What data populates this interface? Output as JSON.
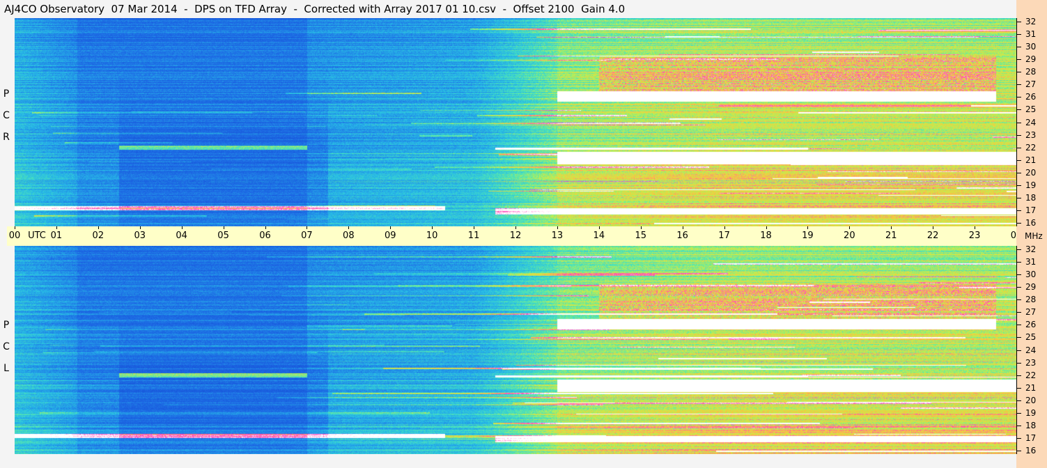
{
  "title": "AJ4CO Observatory  07 Mar 2014  -  DPS on TFD Array  -  Corrected with Array 2017 01 10.csv  -  Offset 2100  Gain 4.0",
  "panels": [
    {
      "id": "top",
      "polarization_letters": [
        "P",
        "C",
        "R"
      ]
    },
    {
      "id": "bottom",
      "polarization_letters": [
        "P",
        "C",
        "L"
      ]
    }
  ],
  "time_axis": {
    "labels": [
      "00",
      "01",
      "02",
      "03",
      "04",
      "05",
      "06",
      "07",
      "08",
      "09",
      "10",
      "11",
      "12",
      "13",
      "14",
      "15",
      "16",
      "17",
      "18",
      "19",
      "20",
      "21",
      "22",
      "23",
      "00"
    ],
    "utc_label": "UTC",
    "unit_label": "MHz"
  },
  "freq_axis": {
    "labels": [
      "32",
      "31",
      "30",
      "29",
      "28",
      "27",
      "26",
      "25",
      "24",
      "23",
      "22",
      "21",
      "20",
      "19",
      "18",
      "17",
      "16"
    ]
  },
  "colors": {
    "background": "#f4f4f4",
    "time_band": "#ffffc8",
    "freq_strip": "#fcd9b8",
    "low_intensity": "#1a5fd6",
    "mid_intensity": "#33c8e0",
    "high_intensity": "#ff40c0",
    "saturated": "#ffffff"
  },
  "chart_data": {
    "type": "heatmap",
    "title": "AJ4CO Observatory  07 Mar 2014  -  DPS on TFD Array  -  Corrected with Array 2017 01 10.csv  -  Offset 2100  Gain 4.0",
    "xlabel": "UTC",
    "ylabel": "MHz",
    "xlim": [
      0,
      24
    ],
    "ylim": [
      16,
      32
    ],
    "panels": [
      "RCP",
      "LCP"
    ],
    "description_points": [
      {
        "utc": 2,
        "activity": "low",
        "bright_bands_mhz": [
          17.7,
          19.5,
          21.7
        ]
      },
      {
        "utc": 5,
        "activity": "lowest",
        "bright_bands_mhz": [
          17.7,
          21.7
        ]
      },
      {
        "utc": 10,
        "activity": "low",
        "bright_bands_mhz": [
          17.6
        ]
      },
      {
        "utc": 11,
        "activity": "low",
        "bright_bands_mhz": []
      },
      {
        "utc": 13,
        "activity": "rising",
        "bright_bands_mhz": [
          17.5,
          21.9,
          27
        ]
      },
      {
        "utc": 18,
        "activity": "high",
        "bright_bands_mhz": [
          17.5,
          20.5,
          22,
          26.8,
          27.5
        ]
      },
      {
        "utc": 23,
        "activity": "high",
        "bright_bands_mhz": [
          17.5,
          26.8,
          27.5
        ]
      }
    ]
  }
}
